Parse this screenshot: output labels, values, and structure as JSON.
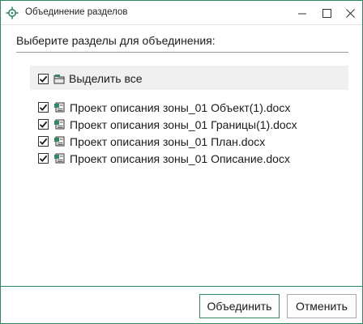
{
  "window": {
    "title": "Объединение разделов",
    "icon": "crosshair-target-icon"
  },
  "instruction": "Выберите разделы для объединения:",
  "select_all": {
    "label": "Выделить все",
    "checked": true,
    "icon": "folder-icon"
  },
  "files": [
    {
      "name": "Проект описания зоны_01 Объект(1).docx",
      "checked": true,
      "icon": "document-icon"
    },
    {
      "name": "Проект описания зоны_01 Границы(1).docx",
      "checked": true,
      "icon": "document-icon"
    },
    {
      "name": "Проект описания зоны_01 План.docx",
      "checked": true,
      "icon": "document-icon"
    },
    {
      "name": "Проект описания зоны_01 Описание.docx",
      "checked": true,
      "icon": "document-icon"
    }
  ],
  "buttons": {
    "merge": "Объединить",
    "cancel": "Отменить"
  },
  "colors": {
    "accent": "#2f8a61",
    "select_all_background": "#f0f0f0"
  }
}
